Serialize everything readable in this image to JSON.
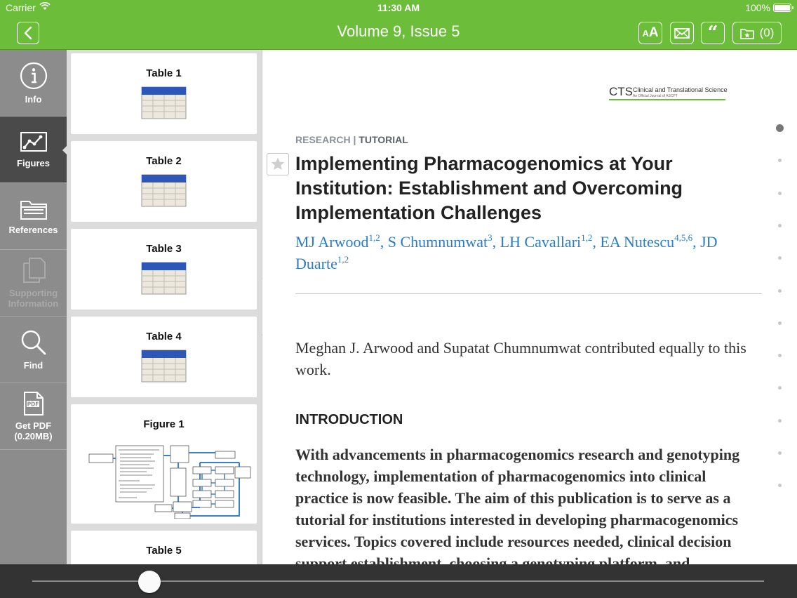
{
  "status_bar": {
    "carrier": "Carrier",
    "time": "11:30 AM",
    "battery": "100%"
  },
  "nav": {
    "title": "Volume 9, Issue 5",
    "text_size_label_small": "A",
    "text_size_label_big": "A",
    "quote_label": "“",
    "bookmarks_count": "(0)",
    "icons": {
      "back": "chevron-left-icon",
      "mail": "mail-icon",
      "quote": "quote-icon",
      "bookmarks": "star-folder-icon"
    }
  },
  "sidebar": {
    "items": [
      {
        "label": "Info",
        "icon": "info-icon"
      },
      {
        "label": "Figures",
        "icon": "chart-icon",
        "active": true
      },
      {
        "label": "References",
        "icon": "folder-icon"
      },
      {
        "label": "Supporting Information",
        "icon": "copy-icon",
        "disabled": true
      },
      {
        "label": "Find",
        "icon": "search-icon"
      },
      {
        "label": "Get PDF (0.20MB)",
        "icon": "pdf-icon"
      }
    ]
  },
  "figures": [
    {
      "title": "Table 1",
      "kind": "table"
    },
    {
      "title": "Table 2",
      "kind": "table"
    },
    {
      "title": "Table 3",
      "kind": "table"
    },
    {
      "title": "Table 4",
      "kind": "table"
    },
    {
      "title": "Figure 1",
      "kind": "figure"
    },
    {
      "title": "Table 5",
      "kind": "table"
    }
  ],
  "article": {
    "journal_abbr": "CTS",
    "journal_name": "Clinical and Translational Science",
    "journal_sub": "An Official Journal of ASCPT",
    "section": "RESEARCH",
    "section_sep": " | ",
    "section_type": "TUTORIAL",
    "title": "Implementing Pharmacogenomics at Your Institution: Establishment and Overcoming Implementation Challenges",
    "authors": [
      {
        "name": "MJ Arwood",
        "aff": "1,2"
      },
      {
        "name": "S Chumnumwat",
        "aff": "3"
      },
      {
        "name": "LH Cavallari",
        "aff": "1,2"
      },
      {
        "name": "EA Nutescu",
        "aff": "4,5,6"
      },
      {
        "name": "JD Duarte",
        "aff": "1,2"
      }
    ],
    "contribution_note": "Meghan J. Arwood and Supatat Chumnumwat contributed equally to this work.",
    "intro_heading": "INTRODUCTION",
    "abstract": "With advancements in pharmacogenomics research and genotyping technology, implementation of pharmacogenomics into clinical practice is now feasible. The aim of this publication is to serve as a tutorial for institutions interested in developing pharmacogenomics services. Topics covered include resources needed, clinical decision support establishment, choosing a genotyping platform, and"
  },
  "pager": {
    "dots": 12,
    "current_index": 1
  },
  "reader_progress": 0.16,
  "colors": {
    "accent": "#6cbd3a",
    "link": "#2b7cc4",
    "sidebar": "#8c8c8c",
    "sidebar_active": "#4a4a4a"
  }
}
